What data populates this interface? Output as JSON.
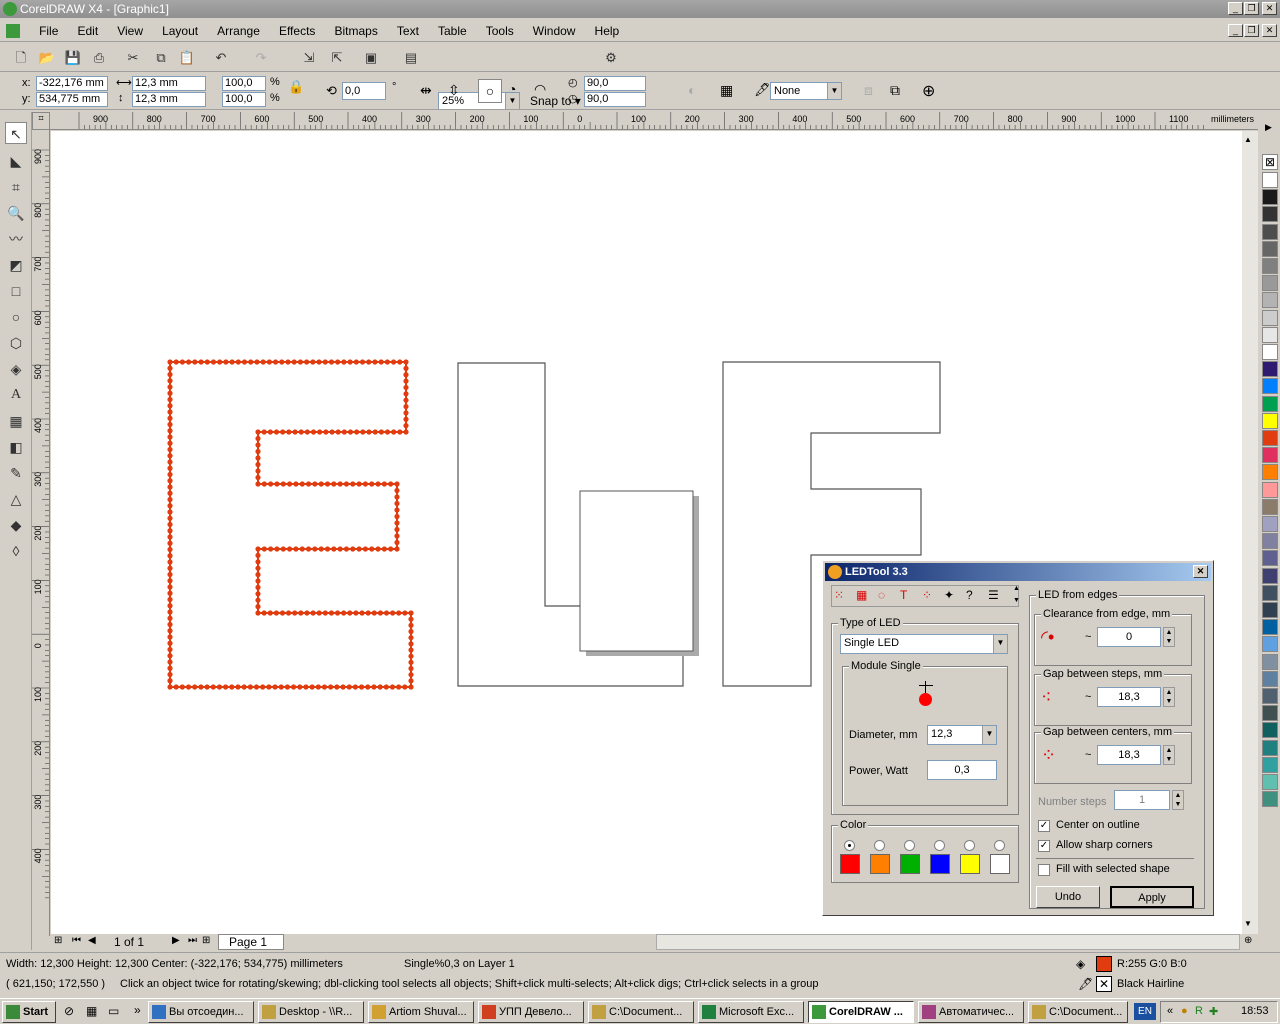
{
  "window": {
    "title": "CorelDRAW X4 - [Graphic1]"
  },
  "menu": [
    "File",
    "Edit",
    "View",
    "Layout",
    "Arrange",
    "Effects",
    "Bitmaps",
    "Text",
    "Table",
    "Tools",
    "Window",
    "Help"
  ],
  "toolbar": {
    "zoom": "25%",
    "snap_label": "Snap to"
  },
  "props": {
    "x_label": "x:",
    "x": "-322,176 mm",
    "y_label": "y:",
    "y": "534,775 mm",
    "w": "12,3 mm",
    "h": "12,3 mm",
    "sx": "100,0",
    "sy": "100,0",
    "pct": "%",
    "rot": "0,0",
    "deg": "°",
    "a1": "90,0",
    "a2": "90,0",
    "outline": "None"
  },
  "ruler": {
    "units": "millimeters",
    "h_ticks": [
      "900",
      "800",
      "700",
      "600",
      "500",
      "400",
      "300",
      "200",
      "100",
      "0",
      "100",
      "200",
      "300",
      "400",
      "500",
      "600",
      "700",
      "800",
      "900",
      "1000",
      "1100"
    ],
    "v_ticks": [
      "900",
      "800",
      "700",
      "600",
      "500",
      "400",
      "300",
      "200",
      "100",
      "0",
      "100",
      "200",
      "300",
      "400"
    ]
  },
  "pagebar": {
    "count": "1 of 1",
    "page": "Page 1"
  },
  "status": {
    "line1": "Width: 12,300  Height: 12,300  Center: (-322,176; 534,775)  millimeters",
    "layer": "Single%0,3 on Layer 1",
    "coords": "( 621,150; 172,550 )",
    "hint": "Click an object twice for rotating/skewing; dbl-clicking tool selects all objects; Shift+click multi-selects; Alt+click digs; Ctrl+click selects in a group",
    "fill": "R:255 G:0 B:0",
    "outline": "Black  Hairline",
    "fill_color": "#e03c10"
  },
  "dialog": {
    "title": "LEDTool 3.3",
    "type_label": "Type of LED",
    "type_value": "Single LED",
    "module_label": "Module Single",
    "diameter_label": "Diameter, mm",
    "diameter": "12,3",
    "power_label": "Power, Watt",
    "power": "0,3",
    "color_label": "Color",
    "colors": [
      "#ff0000",
      "#ff8000",
      "#00b000",
      "#0000ff",
      "#ffff00",
      "#ffffff"
    ],
    "edges_label": "LED from edges",
    "clearance_label": "Clearance from edge, mm",
    "clearance": "0",
    "gap_steps_label": "Gap between steps, mm",
    "gap_steps": "18,3",
    "gap_centers_label": "Gap between centers, mm",
    "gap_centers": "18,3",
    "number_steps_label": "Number steps",
    "number_steps": "1",
    "center_label": "Center on outline",
    "sharp_label": "Allow sharp corners",
    "fill_label": "Fill with selected shape",
    "undo": "Undo",
    "apply": "Apply",
    "tilde": "~"
  },
  "taskbar": {
    "start": "Start",
    "tasks": [
      "Вы отсоедин...",
      "Desktop - \\\\R...",
      "Artiom Shuval...",
      "УПП Девело...",
      "C:\\Document...",
      "Microsoft Exc...",
      "CorelDRAW ...",
      "Автоматичес...",
      "C:\\Document..."
    ],
    "lang": "EN",
    "time": "18:53"
  },
  "palette": [
    "#ffffff",
    "#1a1a1a",
    "#333333",
    "#4d4d4d",
    "#666666",
    "#808080",
    "#999999",
    "#b3b3b3",
    "#cccccc",
    "#e6e6e6",
    "#ffffff",
    "#2e1a6e",
    "#0080ff",
    "#00a050",
    "#ffff00",
    "#e03c10",
    "#e03060",
    "#ff8000",
    "#ff9999",
    "#8b7b6b",
    "#a0a0c0",
    "#8080a0",
    "#606090",
    "#404070",
    "#405060",
    "#304050",
    "#0060a0",
    "#60a0e0",
    "#8090a0",
    "#6080a0",
    "#506070",
    "#405050",
    "#106060",
    "#208080",
    "#30a0a0",
    "#60c0b0",
    "#409080"
  ]
}
